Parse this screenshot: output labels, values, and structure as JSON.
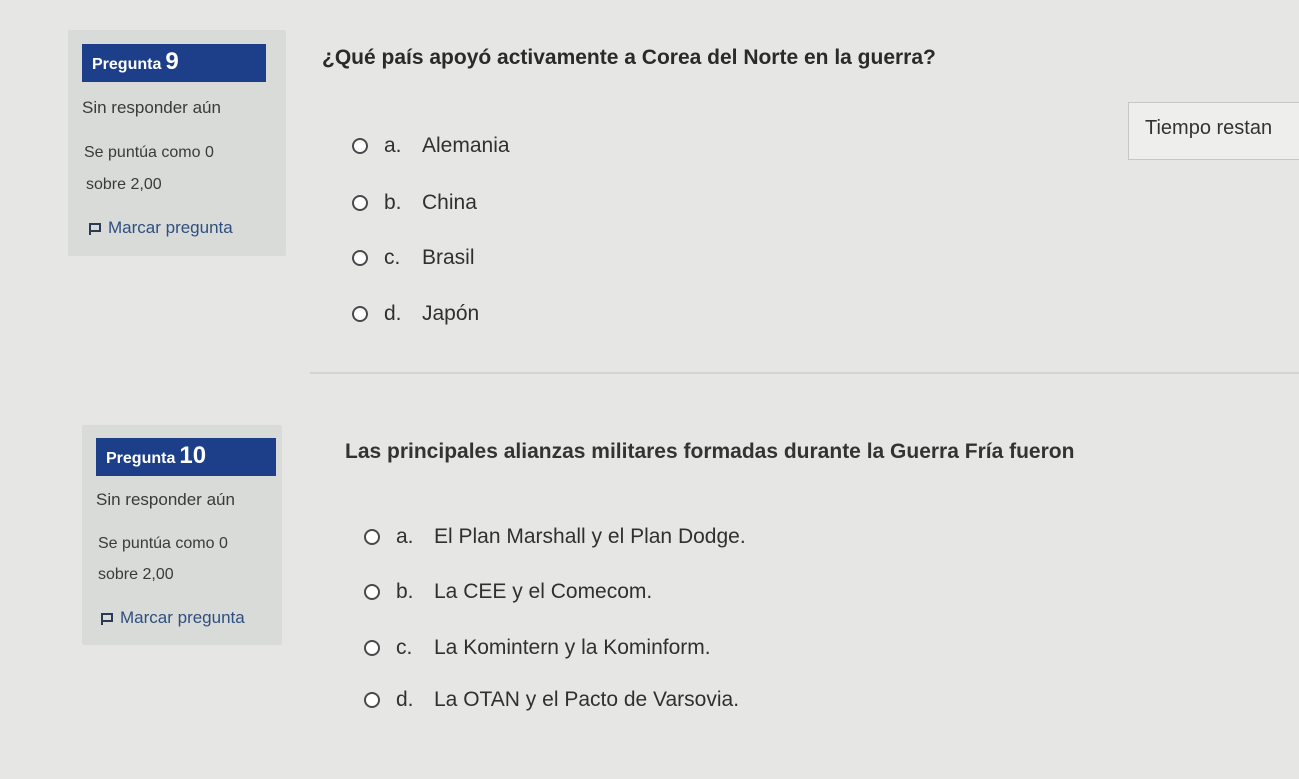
{
  "timer": {
    "label": "Tiempo restan"
  },
  "questions": [
    {
      "label": "Pregunta",
      "number": "9",
      "status": "Sin responder aún",
      "grade": "Se puntúa como 0",
      "out_of": "sobre 2,00",
      "flag_label": "Marcar pregunta",
      "prompt": "¿Qué país apoyó activamente a Corea del Norte en la guerra?",
      "options": [
        {
          "letter": "a.",
          "text": "Alemania"
        },
        {
          "letter": "b.",
          "text": "China"
        },
        {
          "letter": "c.",
          "text": "Brasil"
        },
        {
          "letter": "d.",
          "text": "Japón"
        }
      ]
    },
    {
      "label": "Pregunta",
      "number": "10",
      "status": "Sin responder aún",
      "grade": "Se puntúa como 0",
      "out_of": "sobre 2,00",
      "flag_label": "Marcar pregunta",
      "prompt": "Las principales alianzas militares formadas durante la Guerra Fría fueron",
      "options": [
        {
          "letter": "a.",
          "text": "El Plan Marshall y el Plan Dodge."
        },
        {
          "letter": "b.",
          "text": "La CEE y el Comecom."
        },
        {
          "letter": "c.",
          "text": "La Komintern y la Kominform."
        },
        {
          "letter": "d.",
          "text": "La OTAN y el Pacto de Varsovia."
        }
      ]
    }
  ]
}
